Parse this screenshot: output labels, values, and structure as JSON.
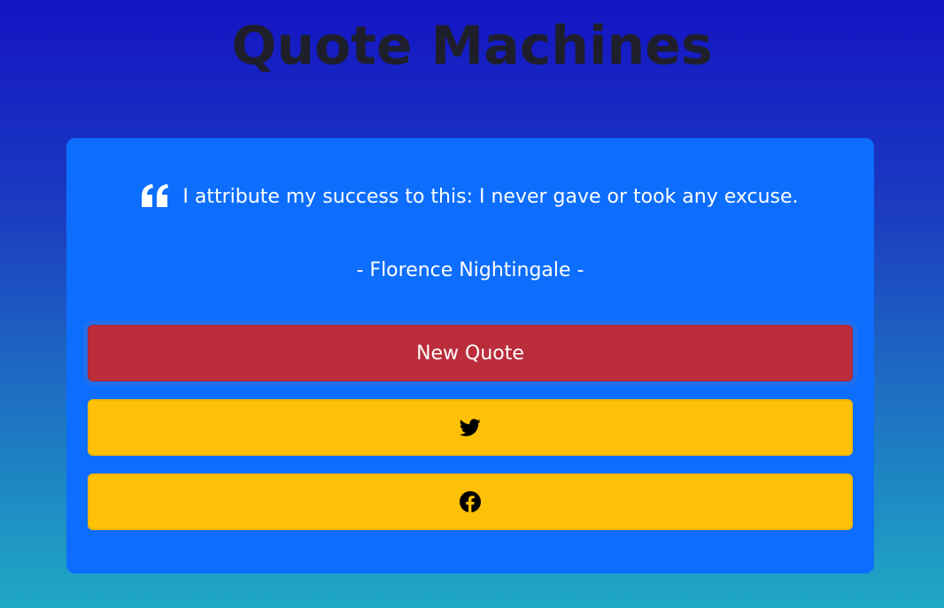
{
  "header": {
    "title": "Quote Machines"
  },
  "quote": {
    "icon": "quote-left-icon",
    "text": "I attribute my success to this: I never gave or took any excuse.",
    "author": "- Florence Nightingale -"
  },
  "buttons": {
    "new_quote_label": "New Quote",
    "twitter_icon": "twitter-icon",
    "facebook_icon": "facebook-icon"
  },
  "colors": {
    "card_background": "#0d6efd",
    "new_quote_button": "#bb2d3b",
    "share_button": "#ffc107",
    "title_text": "#1f1f2b",
    "gradient_top": "#1414c4",
    "gradient_bottom": "#1fa8c5"
  }
}
